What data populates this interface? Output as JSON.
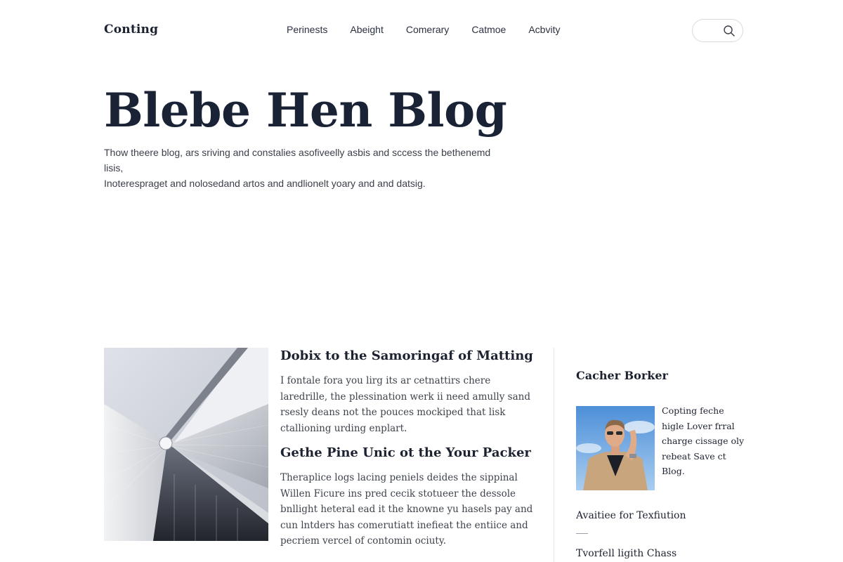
{
  "header": {
    "brand": "Conting",
    "nav": [
      "Perinests",
      "Abeight",
      "Comerary",
      "Catmoe",
      "Acbvity"
    ],
    "search_icon": "search-icon"
  },
  "hero": {
    "title": "Blebe Hen Blog",
    "text_line1": "Thow theere blog, ars sriving and constalies asofiveelly asbis and sccess the bethenemd lisis,",
    "text_line2": "Inoterespraget and nolosedand artos and andlionelt yoary and and datsig."
  },
  "articles": [
    {
      "title": "Dobix to the Samoringaf of Matting",
      "body": "I fontale fora you lirg its ar cetnattirs chere laredrille, the plessination werk ii need amully sand rsesly deans not the pouces mockiped that lisk ctallioning urding enplart."
    },
    {
      "title": "Gethe Pine Unic ot the Your Packer",
      "body": "Theraplice logs lacing peniels deides the sippinal Willen Ficure ins pred cecik stotueer the dessole bnllight heteral ead it the knowne yu hasels pay and cun lntders has comerutiatt inefieat the entiice and pecriem vercel of contomin ociuty."
    }
  ],
  "sidebar": {
    "heading": "Cacher Borker",
    "author_text": "Copting feche higle Lover frral charge cissage oly rebeat Save ct Blog.",
    "link1": "Avaitiee for Texfiution",
    "link2": "Tvorfell ligith Chass"
  },
  "colors": {
    "heading": "#1a2236",
    "text": "#3a3f4a",
    "divider": "#e4e6ea"
  }
}
